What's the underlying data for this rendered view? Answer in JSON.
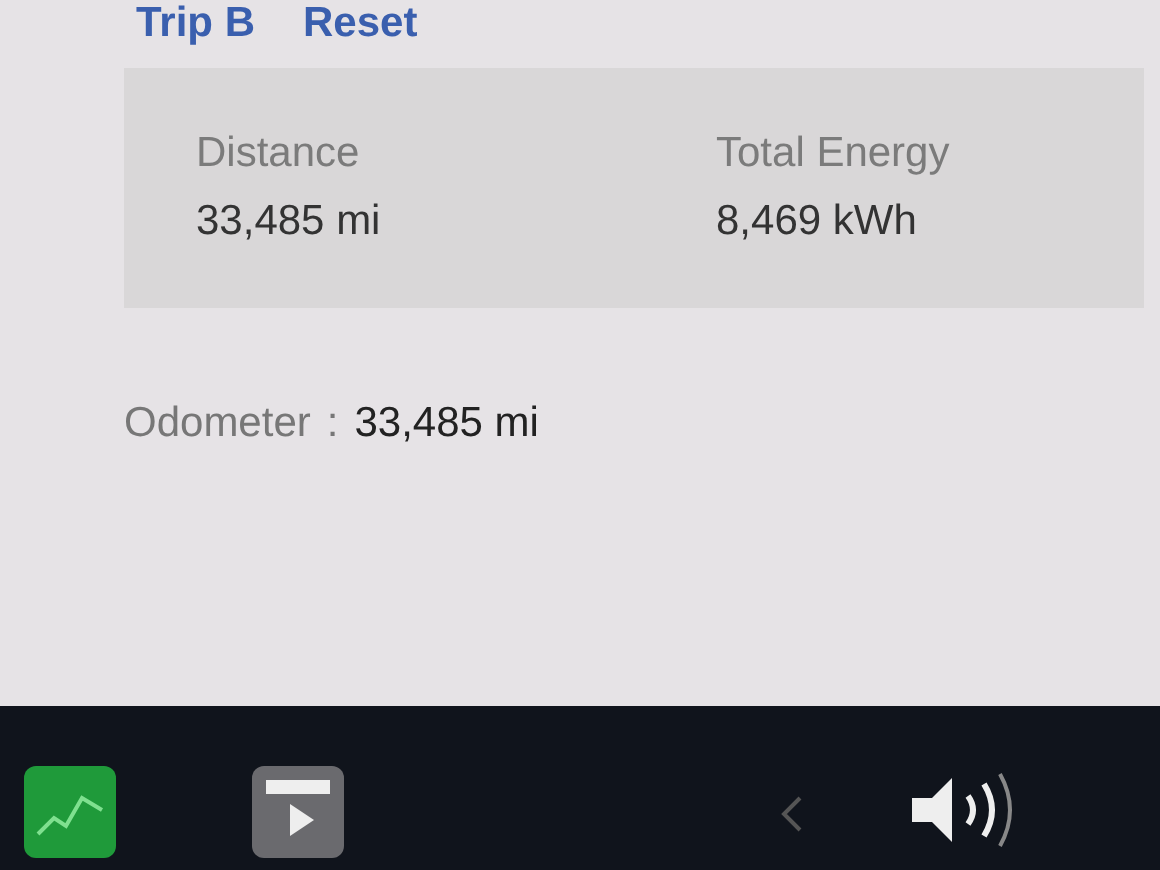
{
  "trip_header": {
    "title": "Trip B",
    "action": "Reset"
  },
  "stats": [
    {
      "label": "Distance",
      "value": "33,485 mi"
    },
    {
      "label": "Total Energy",
      "value": "8,469 kWh"
    }
  ],
  "odometer": {
    "label": "Odometer",
    "separator": ":",
    "value": "33,485 mi"
  },
  "taskbar": [
    {
      "kind": "energy-app"
    },
    {
      "kind": "media-app"
    },
    {
      "kind": "chevron"
    },
    {
      "kind": "volume"
    }
  ]
}
